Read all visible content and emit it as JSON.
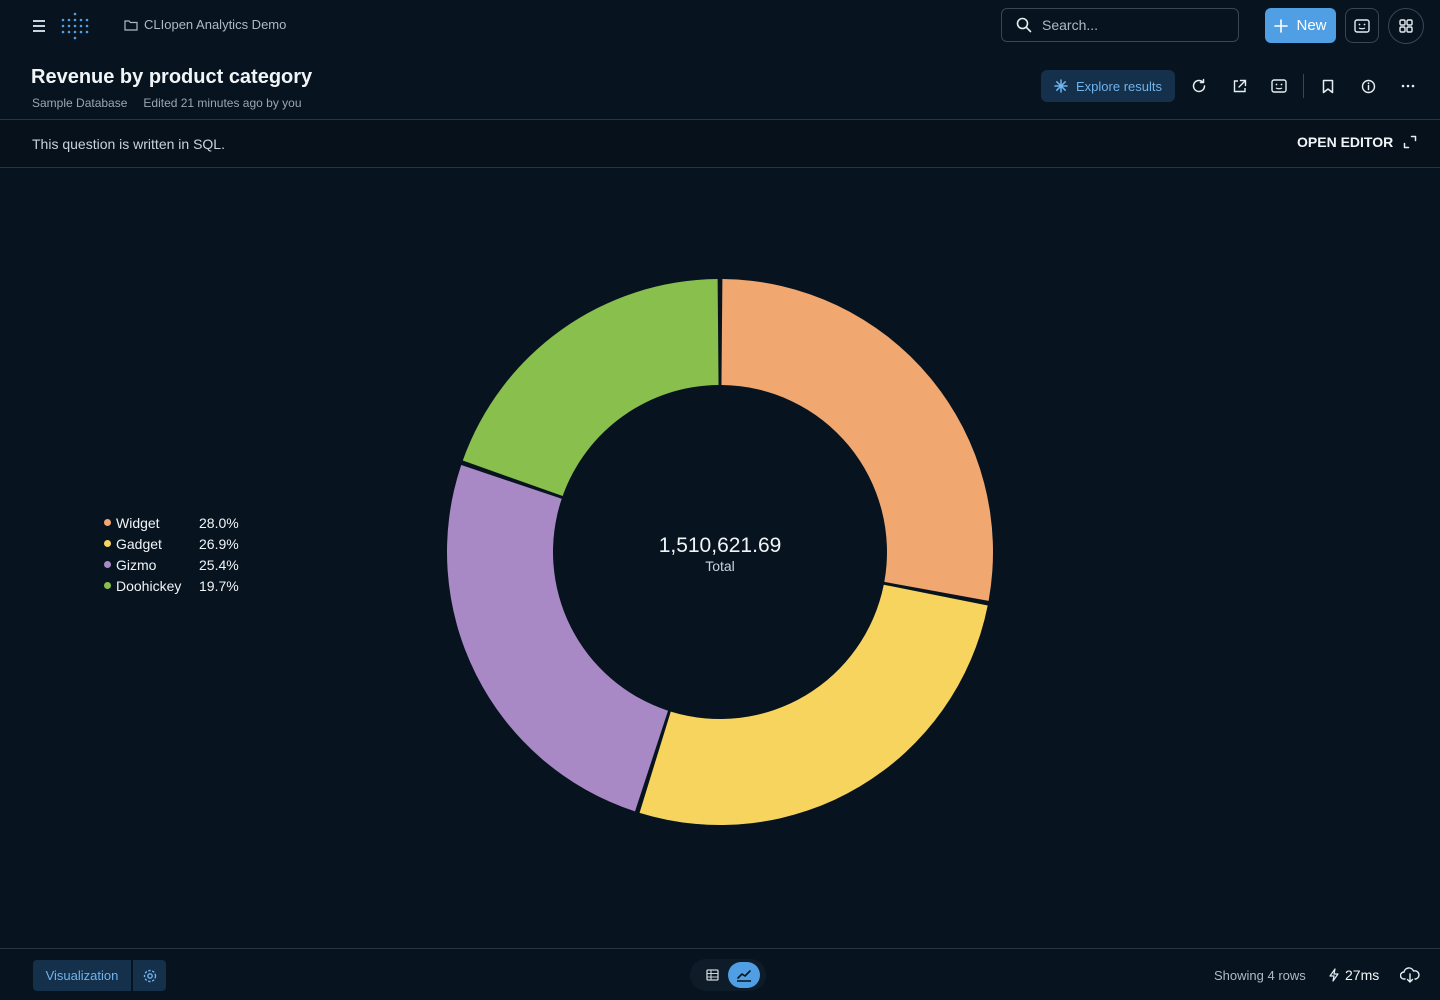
{
  "topbar": {
    "collection": "CLIopen Analytics Demo",
    "search_placeholder": "Search...",
    "new_label": "New"
  },
  "question": {
    "title": "Revenue by product category",
    "database": "Sample Database",
    "edited": "Edited 21 minutes ago by you",
    "explore_label": "Explore results"
  },
  "sql_bar": {
    "notice": "This question is written in SQL.",
    "open_editor_label": "OPEN EDITOR"
  },
  "chart_data": {
    "type": "pie",
    "total_value": "1,510,621.69",
    "total_label": "Total",
    "slices": [
      {
        "label": "Widget",
        "percent_label": "28.0%",
        "fraction": 0.28,
        "color": "#f0a770"
      },
      {
        "label": "Gadget",
        "percent_label": "26.9%",
        "fraction": 0.269,
        "color": "#f7d45e"
      },
      {
        "label": "Gizmo",
        "percent_label": "25.4%",
        "fraction": 0.254,
        "color": "#a989c5"
      },
      {
        "label": "Doohickey",
        "percent_label": "19.7%",
        "fraction": 0.197,
        "color": "#88bf4d"
      }
    ]
  },
  "footer": {
    "visualization_label": "Visualization",
    "rows_text": "Showing 4 rows",
    "timing": "27ms"
  },
  "colors": {
    "background": "#07141f",
    "accent": "#509ee3",
    "accent_muted": "#15304a"
  }
}
